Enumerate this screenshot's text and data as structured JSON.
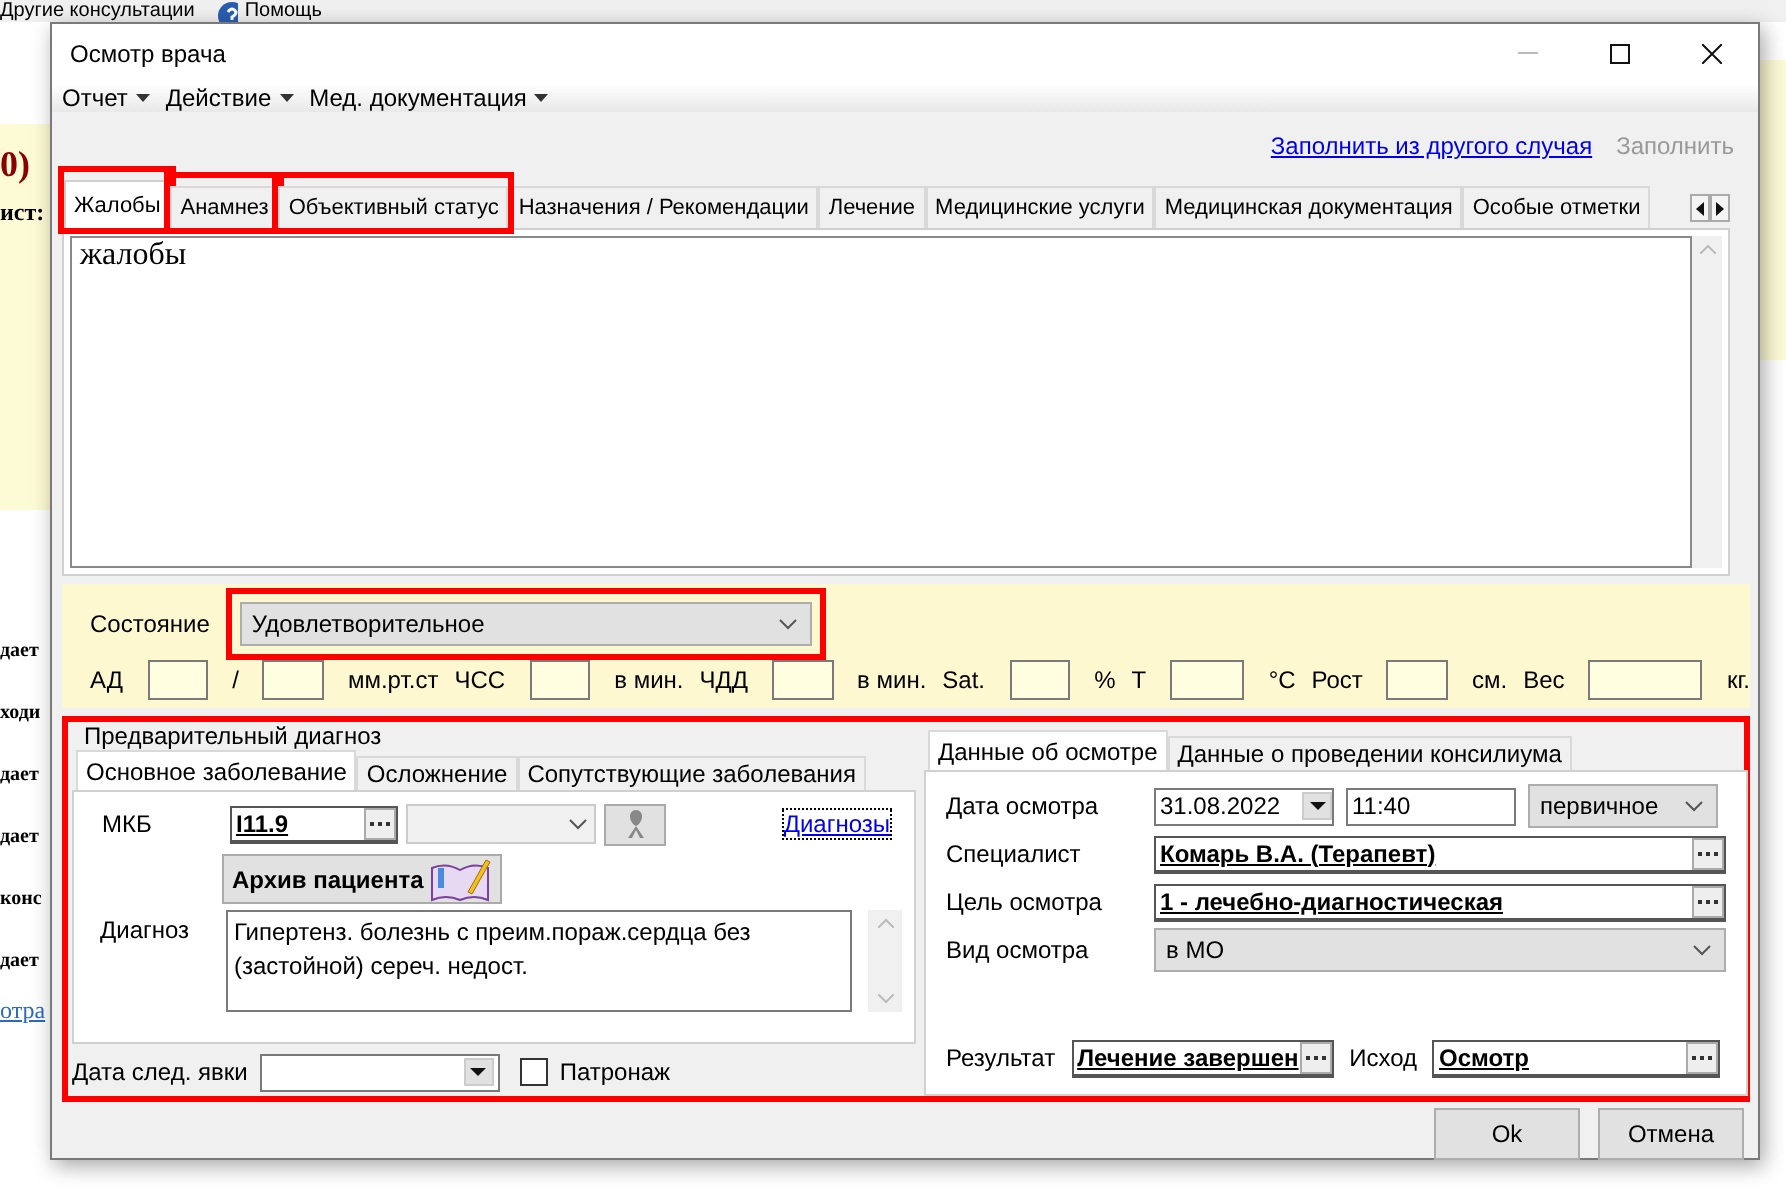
{
  "background_app": {
    "menu": [
      {
        "label": "Другие консультации"
      },
      {
        "label": "Помощь"
      }
    ],
    "upper_texts": [
      "0)",
      "ист:"
    ],
    "lower_texts": [
      {
        "text": "дает",
        "kind": "text"
      },
      {
        "text": "ходи",
        "kind": "text"
      },
      {
        "text": "дает",
        "kind": "text"
      },
      {
        "text": "дает",
        "kind": "text"
      },
      {
        "text": "конс",
        "kind": "text"
      },
      {
        "text": "дает",
        "kind": "text"
      },
      {
        "text": "отра",
        "kind": "link"
      }
    ]
  },
  "window": {
    "title": "Осмотр врача"
  },
  "menu": [
    {
      "label": "Отчет"
    },
    {
      "label": "Действие"
    },
    {
      "label": "Мед. документация"
    }
  ],
  "links": [
    {
      "label": "Заполнить из другого случая",
      "disabled": false
    },
    {
      "label": "Заполнить",
      "disabled": true
    }
  ],
  "tabs": [
    {
      "label": "Жалобы",
      "selected": true,
      "highlighted": true
    },
    {
      "label": "Анамнез",
      "selected": false,
      "highlighted": true
    },
    {
      "label": "Объективный статус",
      "selected": false,
      "highlighted": true
    },
    {
      "label": "Назначения / Рекомендации",
      "selected": false,
      "highlighted": false
    },
    {
      "label": "Лечение",
      "selected": false,
      "highlighted": false
    },
    {
      "label": "Медицинские услуги",
      "selected": false,
      "highlighted": false
    },
    {
      "label": "Медицинская документация",
      "selected": false,
      "highlighted": false
    },
    {
      "label": "Особые отметки",
      "selected": false,
      "highlighted": false
    }
  ],
  "complaints": {
    "value": "жалобы"
  },
  "condition": {
    "label": "Состояние",
    "value": "Удовлетворительное",
    "highlighted": true
  },
  "vitals": [
    {
      "kind": "label",
      "text": "АД"
    },
    {
      "kind": "field"
    },
    {
      "kind": "label",
      "text": "/"
    },
    {
      "kind": "field"
    },
    {
      "kind": "label",
      "text": "мм.рт.ст"
    },
    {
      "kind": "label",
      "text": "ЧСС"
    },
    {
      "kind": "field"
    },
    {
      "kind": "label",
      "text": "в мин."
    },
    {
      "kind": "label",
      "text": "ЧДД"
    },
    {
      "kind": "field"
    },
    {
      "kind": "label",
      "text": "в мин."
    },
    {
      "kind": "label",
      "text": "Sat."
    },
    {
      "kind": "field"
    },
    {
      "kind": "label",
      "text": "%"
    },
    {
      "kind": "label",
      "text": "Т"
    },
    {
      "kind": "wide_field"
    },
    {
      "kind": "label",
      "text": "°С"
    },
    {
      "kind": "label",
      "text": "Рост"
    },
    {
      "kind": "field"
    },
    {
      "kind": "label",
      "text": "см."
    },
    {
      "kind": "label",
      "text": "Вес"
    },
    {
      "kind": "wider_field"
    },
    {
      "kind": "label",
      "text": "кг."
    }
  ],
  "bottom_section": {
    "highlighted": true,
    "diagnosis": {
      "title": "Предварительный диагноз",
      "tabs": [
        {
          "label": "Основное заболевание",
          "selected": true
        },
        {
          "label": "Осложнение",
          "selected": false
        },
        {
          "label": "Сопутствующие заболевания",
          "selected": false
        }
      ],
      "mkb": {
        "label": "МКБ",
        "value": "I11.9"
      },
      "diagnoses_link": "Диагнозы",
      "archive_button": "Архив пациента",
      "diagnosis": {
        "label": "Диагноз",
        "value": "Гипертенз. болезнь с преим.пораж.сердца без (застойной) сереч. недост."
      },
      "next_visit": {
        "label": "Дата след. явки"
      },
      "patronage": {
        "label": "Патронаж",
        "checked": false
      }
    },
    "exam": {
      "tabs": [
        {
          "label": "Данные об осмотре",
          "selected": true
        },
        {
          "label": "Данные о проведении консилиума",
          "selected": false
        }
      ],
      "date": {
        "label": "Дата осмотра",
        "value": "31.08.2022"
      },
      "time": {
        "value": "11:40"
      },
      "visit_type": {
        "value": "первичное"
      },
      "specialist": {
        "label": "Специалист",
        "value": "Комарь В.А. (Терапевт)"
      },
      "purpose": {
        "label": "Цель осмотра",
        "value": "1 - лечебно-диагностическая"
      },
      "kind": {
        "label": "Вид осмотра",
        "value": "в МО"
      },
      "result": {
        "label": "Результат",
        "value": "Лечение завершен"
      },
      "outcome": {
        "label": "Исход",
        "value": "Осмотр"
      }
    }
  },
  "buttons": [
    {
      "label": "Ok"
    },
    {
      "label": "Отмена"
    }
  ]
}
